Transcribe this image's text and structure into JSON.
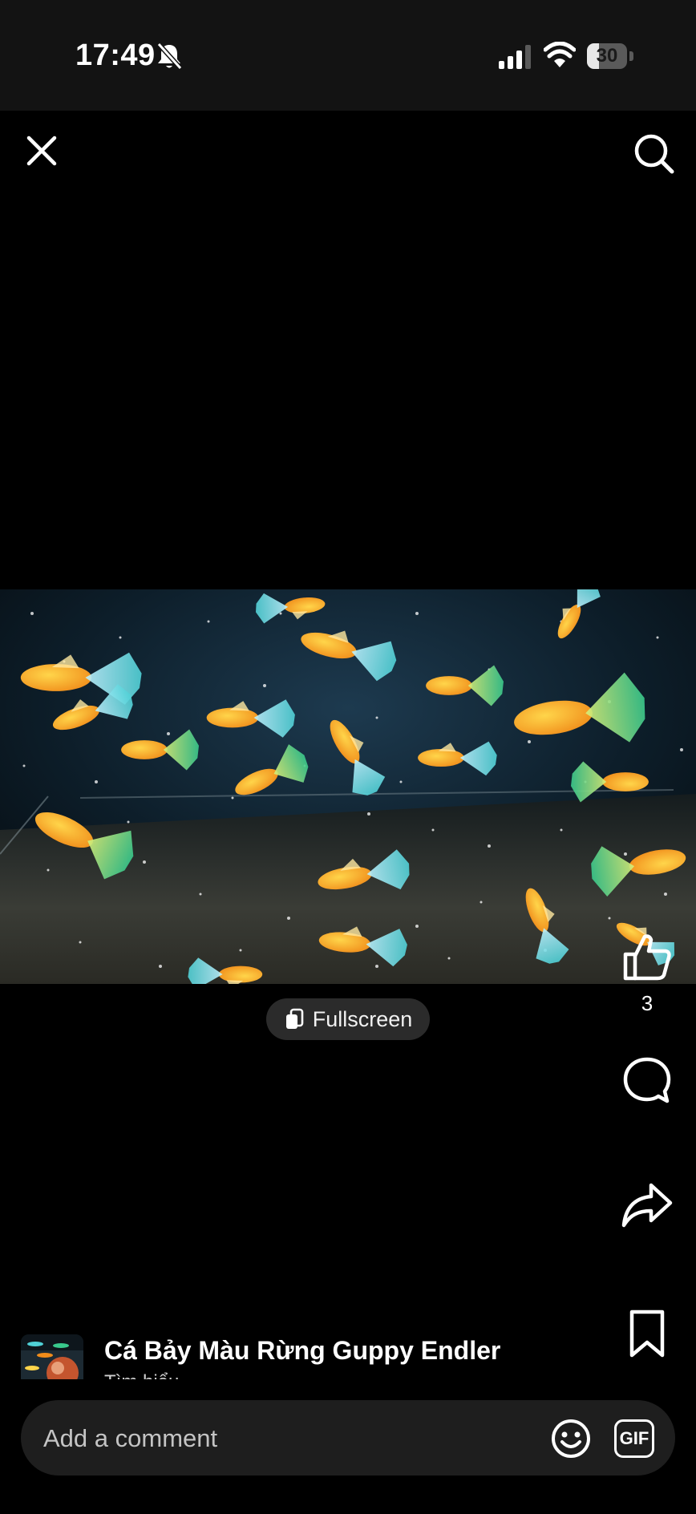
{
  "status_bar": {
    "time": "17:49",
    "battery_level": "30",
    "battery_percent": 30,
    "icons": [
      "bell-muted-icon",
      "cellular-signal-icon",
      "wifi-icon",
      "battery-icon"
    ]
  },
  "header": {
    "close_icon": "close-icon",
    "search_icon": "search-icon"
  },
  "video": {
    "content": "aquarium with guppy fish",
    "fullscreen_label": "Fullscreen"
  },
  "actions": {
    "like_count": "3",
    "icons": [
      "thumbs-up-icon",
      "comment-icon",
      "share-icon",
      "bookmark-icon"
    ]
  },
  "video_info": {
    "title": "Cá Bảy Màu Rừng Guppy Endler",
    "subtitle": "Tìm hiểu"
  },
  "comment_bar": {
    "placeholder": "Add a comment",
    "gif_label": "GIF",
    "emoji_icon": "emoji-icon"
  },
  "colors": {
    "background": "#000000",
    "status_bar": "#131313",
    "comment_bar": "#1e1e1e",
    "fullscreen_pill": "#2b2b2b"
  }
}
